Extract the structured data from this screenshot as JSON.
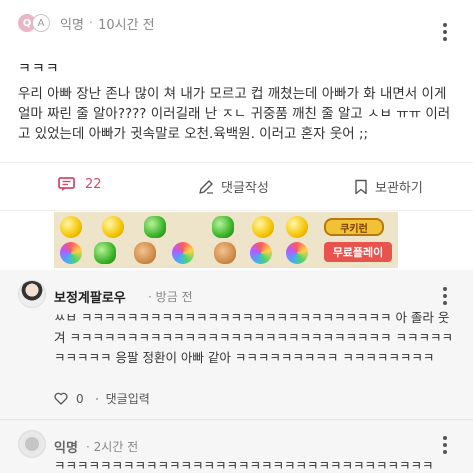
{
  "post": {
    "badges": [
      "Q",
      "A"
    ],
    "author": "익명",
    "separator": "·",
    "time": "10시간 전",
    "title": "ㅋㅋㅋ",
    "body": "우리 아빠 장난 존나 많이 쳐 내가 모르고 컵 깨쳤는데 아빠가 화 내면서 이게 얼마 짜린 줄 알아???? 이러길래 난 ㅈㄴ 귀중품 깨친 줄 알고 ㅅㅂ ㅠㅠ 이러고 있었는데 아빠가 귓속말로 오천.육백원. 이러고 혼자 웃어 ;;"
  },
  "actions": {
    "comment_count": "22",
    "write_comment_label": "댓글작성",
    "save_label": "보관하기"
  },
  "ad": {
    "logo_text": "쿠키런",
    "cta_label": "무료플레이"
  },
  "comments": [
    {
      "author": "보정계팔로우",
      "separator": "·",
      "time": "방금 전",
      "text": "ㅆㅂ ㅋㅋㅋㅋㅋㅋㅋㅋㅋㅋㅋㅋㅋㅋㅋㅋㅋㅋㅋㅋㅋㅋㅋㅋㅋㅋㅋ 아 졸라 웃겨 ㅋㅋㅋㅋㅋㅋㅋㅋㅋㅋㅋㅋㅋㅋㅋㅋㅋㅋㅋㅋㅋㅋㅋㅋㅋㅋㅋㅋ ㅋㅋㅋㅋㅋㅋㅋㅋㅋㅋ 응팔 정환이 아빠 같아 ㅋㅋㅋㅋㅋㅋㅋㅋㅋ ㅋㅋㅋㅋㅋㅋㅋㅋ",
      "like_count": "0",
      "reply_label": "댓글입력"
    },
    {
      "author": "익명",
      "separator": "·",
      "time": "2시간 전",
      "text": "ㅋㅋㅋㅋㅋㅋㅋㅋㅋㅋㅋㅋㅋㅋㅋㅋㅋㅋㅋㅋㅋㅋㅋㅋㅋㅋㅋㅋㅋㅋㅋㅋㅋ"
    }
  ],
  "colors": {
    "accent": "#d64a6a",
    "ad_cta": "#e8534e",
    "comments_bg": "#f6f6f6"
  },
  "icons": {
    "comment": "speech-bubble-icon",
    "write": "pencil-icon",
    "save": "bookmark-icon",
    "more": "kebab-menu-icon",
    "like": "heart-icon"
  }
}
